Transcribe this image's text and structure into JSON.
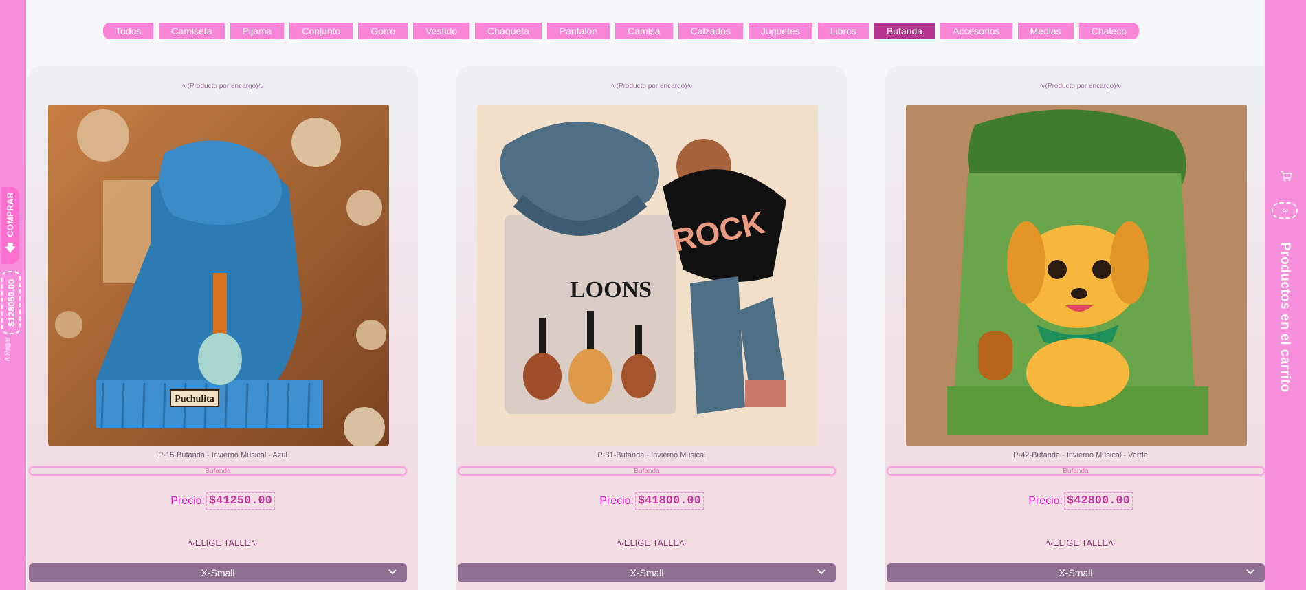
{
  "categories": [
    "Todos",
    "Camiseta",
    "Pijama",
    "Conjunto",
    "Gorro",
    "Vestido",
    "Chaqueta",
    "Pantalón",
    "Camisa",
    "Calzados",
    "Juguetes",
    "Libros",
    "Bufanda",
    "Accesorios",
    "Medias",
    "Chaleco"
  ],
  "active_category": "Bufanda",
  "left_rail": {
    "buy_label": "COMPRAR",
    "total": "$128050.00",
    "to_pay_label": "A Pagar"
  },
  "right_rail": {
    "cart_count": "3",
    "cart_title": "Productos en el carrito"
  },
  "products": [
    {
      "order_note": "∿(Producto por encargo)∿",
      "name": "P-15-Bufanda - Invierno Musical - Azul",
      "category": "Bufanda",
      "price_label": "Precio:",
      "price": "$41250.00",
      "size_label": "∿ELIGE TALLE∿",
      "size": "X-Small",
      "tag_text": "Puchulita"
    },
    {
      "order_note": "∿(Producto por encargo)∿",
      "name": "P-31-Bufanda - Invierno Musical",
      "category": "Bufanda",
      "price_label": "Precio:",
      "price": "$41800.00",
      "size_label": "∿ELIGE TALLE∿",
      "size": "X-Small",
      "hat_text": "ROCK"
    },
    {
      "order_note": "∿(Producto por encargo)∿",
      "name": "P-42-Bufanda - Invierno Musical - Verde",
      "category": "Bufanda",
      "price_label": "Precio:",
      "price": "$42800.00",
      "size_label": "∿ELIGE TALLE∿",
      "size": "X-Small"
    }
  ],
  "colors": {
    "rail_pink": "#f68fdc",
    "pill_pink": "#f985d6",
    "pill_active": "#b6338f",
    "price_pink": "#e11fc0",
    "select_purple": "#8e6e91"
  }
}
